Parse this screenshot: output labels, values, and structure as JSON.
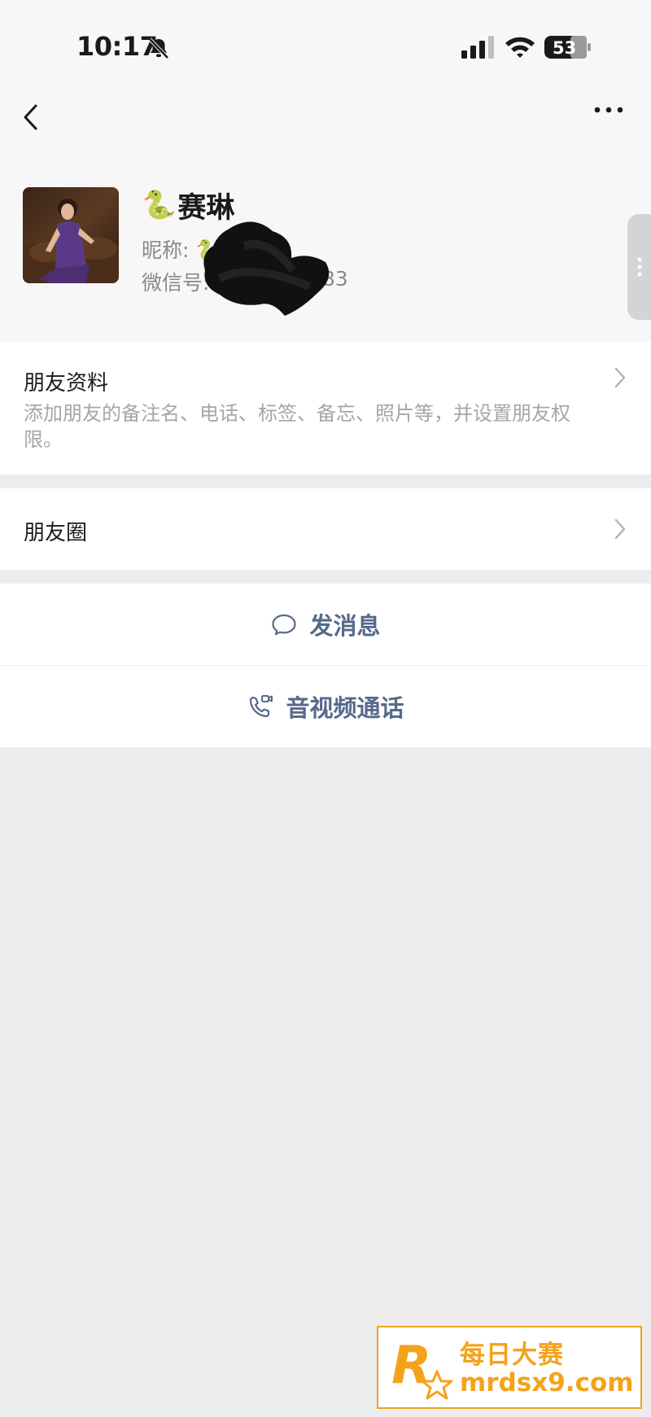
{
  "status_bar": {
    "time": "10:17",
    "battery": "53"
  },
  "profile": {
    "emoji": "🐍",
    "name": "赛琳",
    "nickname_label": "昵称: ",
    "nickname_emoji": "🐍",
    "wechat_id_label": "微信号: ",
    "wechat_id_visible_tail": "983"
  },
  "friend_info": {
    "title": "朋友资料",
    "description": "添加朋友的备注名、电话、标签、备忘、照片等，并设置朋友权限。"
  },
  "moments": {
    "title": "朋友圈"
  },
  "actions": {
    "send_message": "发消息",
    "av_call": "音视频通话"
  },
  "watermark": {
    "cn": "每日大赛",
    "url": "mrdsx9.com",
    "logo_letter": "R",
    "logo_small": "每日大赛"
  },
  "colors": {
    "link": "#56698b",
    "accent": "#f5a21b",
    "background": "#ededed"
  }
}
